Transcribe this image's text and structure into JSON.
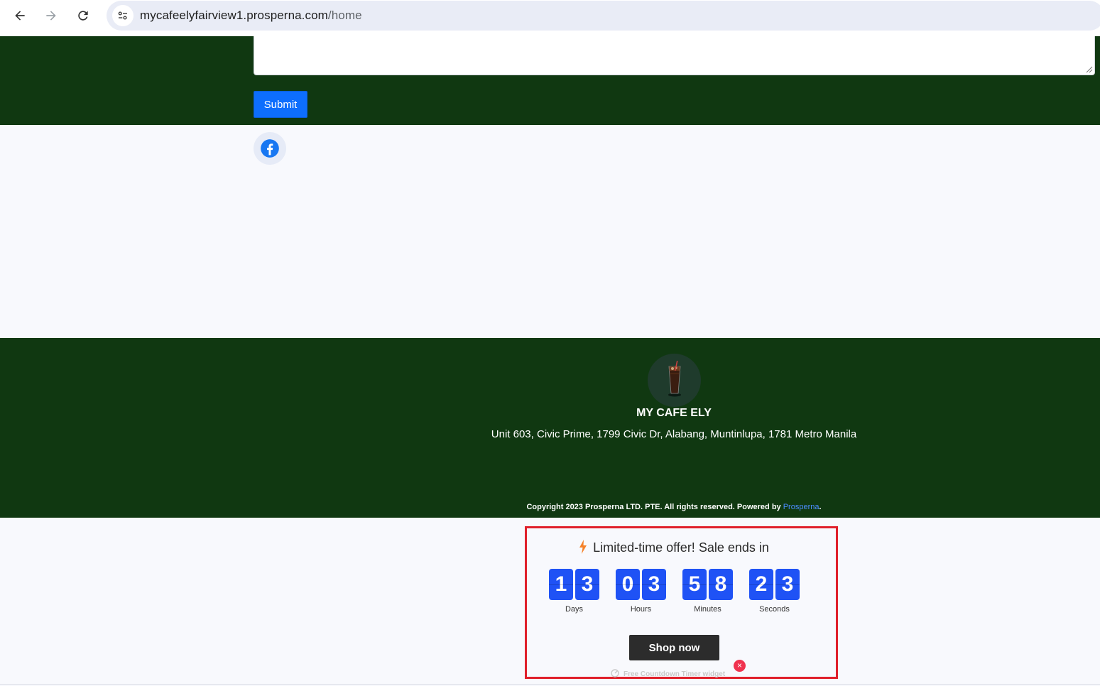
{
  "browser": {
    "back_icon": "arrow-left-icon",
    "forward_icon": "arrow-right-icon",
    "reload_icon": "reload-icon",
    "site_info_icon": "tune-icon",
    "url_domain": "mycafeelyfairview1.prosperna.com",
    "url_path": "/home"
  },
  "form": {
    "message_value": "",
    "submit_label": "Submit"
  },
  "social": {
    "facebook_icon": "facebook-icon"
  },
  "footer": {
    "store_name": "MY CAFE ELY",
    "address": "Unit 603, Civic Prime, 1799 Civic Dr, Alabang, Muntinlupa, 1781 Metro Manila",
    "copyright_prefix": "Copyright 2023 Prosperna LTD. PTE. All rights reserved. Powered by ",
    "copyright_link": "Prosperna",
    "copyright_suffix": "."
  },
  "countdown": {
    "title": "Limited-time offer! Sale ends in",
    "units": [
      {
        "d1": "1",
        "d2": "3",
        "label": "Days"
      },
      {
        "d1": "0",
        "d2": "3",
        "label": "Hours"
      },
      {
        "d1": "5",
        "d2": "8",
        "label": "Minutes"
      },
      {
        "d1": "2",
        "d2": "3",
        "label": "Seconds"
      }
    ],
    "cta_label": "Shop now",
    "credit": "Free Countdown Timer widget",
    "close_symbol": "×"
  },
  "colors": {
    "footer_green": "#103811",
    "submit_blue": "#0d6efd",
    "timer_blue": "#1f52f5",
    "highlight_red": "#e0202b"
  }
}
